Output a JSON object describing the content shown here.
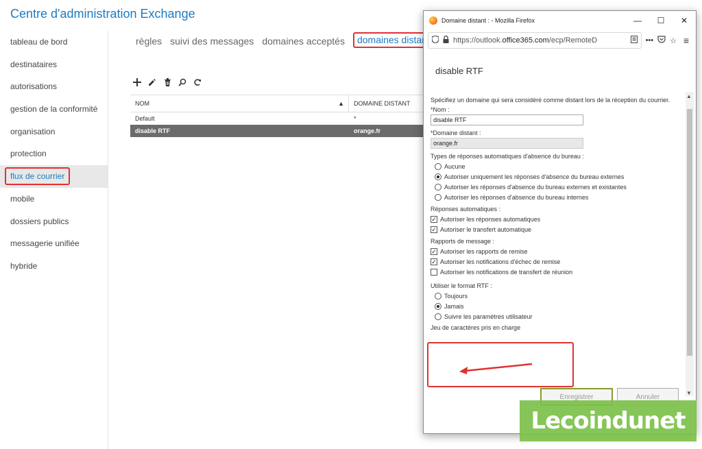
{
  "eac": {
    "title": "Centre d'administration Exchange",
    "nav": [
      "tableau de bord",
      "destinataires",
      "autorisations",
      "gestion de la conformité",
      "organisation",
      "protection",
      "flux de courrier",
      "mobile",
      "dossiers publics",
      "messagerie unifiée",
      "hybride"
    ],
    "active_nav": "flux de courrier",
    "tabs": [
      "règles",
      "suivi des messages",
      "domaines acceptés",
      "domaines distants"
    ],
    "active_tab": "domaines distants",
    "toolbar_icons": [
      "add-icon",
      "edit-icon",
      "delete-icon",
      "search-icon",
      "refresh-icon"
    ],
    "grid": {
      "headers": {
        "name": "NOM",
        "domain": "DOMAINE DISTANT"
      },
      "rows": [
        {
          "name": "Default",
          "domain": "*"
        },
        {
          "name": "disable RTF",
          "domain": "orange.fr"
        }
      ]
    }
  },
  "firefox": {
    "title": "Domaine distant : - Mozilla Firefox",
    "url_prefix": "https://outlook.",
    "url_host": "office365.com",
    "url_rest": "/ecp/RemoteD",
    "url_more": "•••"
  },
  "dialog": {
    "title": "disable RTF",
    "description": "Spécifiez un domaine qui sera considéré comme distant lors de la réception du courrier.",
    "name_label": "*Nom :",
    "name_value": "disable RTF",
    "domain_label": "*Domaine distant :",
    "domain_value": "orange.fr",
    "ooo_label": "Types de réponses automatiques d'absence du bureau :",
    "ooo_options": [
      {
        "label": "Aucune",
        "checked": false
      },
      {
        "label": "Autoriser uniquement les réponses d'absence du bureau externes",
        "checked": true
      },
      {
        "label": "Autoriser les réponses d'absence du bureau externes et existantes",
        "checked": false
      },
      {
        "label": "Autoriser les réponses d'absence du bureau internes",
        "checked": false
      }
    ],
    "auto_label": "Réponses automatiques :",
    "auto_options": [
      {
        "label": "Autoriser les réponses automatiques",
        "checked": true
      },
      {
        "label": "Autoriser le transfert automatique",
        "checked": true
      }
    ],
    "reports_label": "Rapports de message :",
    "reports_options": [
      {
        "label": "Autoriser les rapports de remise",
        "checked": true
      },
      {
        "label": "Autoriser les notifications d'échec de remise",
        "checked": true
      },
      {
        "label": "Autoriser les notifications de transfert de réunion",
        "checked": false
      }
    ],
    "rtf_label": "Utiliser le format RTF :",
    "rtf_options": [
      {
        "label": "Toujours",
        "checked": false
      },
      {
        "label": "Jamais",
        "checked": true
      },
      {
        "label": "Suivre les paramètres utilisateur",
        "checked": false
      }
    ],
    "charset_label": "Jeu de caractères pris en charge",
    "save_label": "Enregistrer",
    "cancel_label": "Annuler"
  },
  "watermark": "Lecoindunet",
  "colors": {
    "accent": "#1b7bc4",
    "highlight": "#e03131",
    "watermark": "#7cc24a"
  }
}
